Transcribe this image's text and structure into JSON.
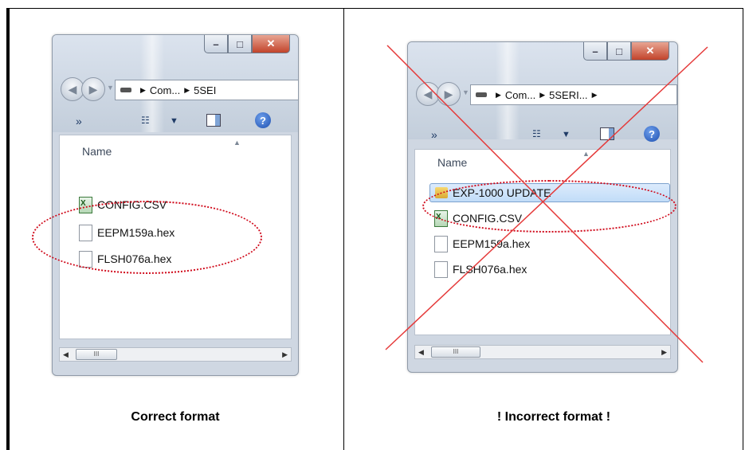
{
  "left": {
    "window": {
      "breadcrumbs": [
        "Com...",
        "5SEI"
      ],
      "toolbar": {
        "more": "»",
        "help": "?"
      },
      "column_header": "Name",
      "files": [
        {
          "name": "CONFIG.CSV",
          "icon": "excel-file-icon"
        },
        {
          "name": "EEPM159a.hex",
          "icon": "file-icon"
        },
        {
          "name": "FLSH076a.hex",
          "icon": "file-icon"
        }
      ],
      "scroll_grip": "III"
    },
    "caption": "Correct format"
  },
  "right": {
    "window": {
      "breadcrumbs": [
        "Com...",
        "5SERI..."
      ],
      "toolbar": {
        "more": "»",
        "help": "?"
      },
      "column_header": "Name",
      "files": [
        {
          "name": "EXP-1000 UPDATE",
          "icon": "folder-icon"
        },
        {
          "name": "CONFIG.CSV",
          "icon": "excel-file-icon"
        },
        {
          "name": "EEPM159a.hex",
          "icon": "file-icon"
        },
        {
          "name": "FLSH076a.hex",
          "icon": "file-icon"
        }
      ],
      "scroll_grip": "III"
    },
    "caption": "! Incorrect format !"
  },
  "colors": {
    "highlight": "#d0091a",
    "cross": "#e53a3a"
  }
}
